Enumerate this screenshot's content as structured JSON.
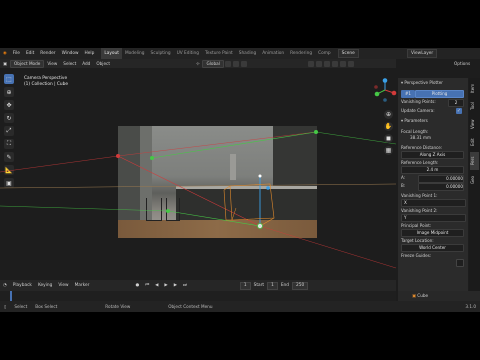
{
  "topbar": {
    "menus": [
      "File",
      "Edit",
      "Render",
      "Window",
      "Help"
    ],
    "workspaces": [
      "Layout",
      "Modeling",
      "Sculpting",
      "UV Editing",
      "Texture Paint",
      "Shading",
      "Animation",
      "Rendering",
      "Comp"
    ],
    "active_workspace": "Layout",
    "scene": "Scene",
    "view_layer": "ViewLayer"
  },
  "header": {
    "mode": "Object Mode",
    "menus": [
      "View",
      "Select",
      "Add",
      "Object"
    ],
    "orientation": "Global",
    "options": "Options"
  },
  "viewport": {
    "camera_label": "Camera Perspective",
    "collection_label": "(1) Collection | Cube"
  },
  "panel": {
    "title": "Perspective Plotter",
    "id_field": "#1",
    "plotting_button": "Plotting",
    "vanishing_points_label": "Vanishing Points:",
    "vanishing_points_value": "2",
    "update_camera_label": "Update Camera:",
    "parameters_header": "Parameters",
    "focal_length_label": "Focal Length:",
    "focal_length_value": "38.31 mm",
    "reference_distance_label": "Reference Distance:",
    "reference_distance_value": "Along Z Axis",
    "reference_length_label": "Reference Length:",
    "reference_length_value": "2.4 m",
    "a_label": "A:",
    "a_value": "0.00000",
    "b_label": "B:",
    "b_value": "0.00000",
    "vp1_label": "Vanishing Point 1:",
    "vp1_value": "X",
    "vp2_label": "Vanishing Point 2:",
    "vp2_value": "Y",
    "principal_point_label": "Principal Point:",
    "principal_point_value": "Image Midpoint",
    "target_location_label": "Target Location:",
    "target_location_value": "World Center",
    "freeze_guides_label": "Freeze Guides:"
  },
  "side_tabs": [
    "Item",
    "Tool",
    "View",
    "Edit",
    "Pers",
    "Geo"
  ],
  "timeline": {
    "menus": [
      "Playback",
      "Keying",
      "View",
      "Marker"
    ],
    "current_frame": "1",
    "start_label": "Start",
    "start_value": "1",
    "end_label": "End",
    "end_value": "250"
  },
  "outliner_item": "Cube",
  "status": {
    "select": "Select",
    "box_select": "Box Select",
    "rotate_view": "Rotate View",
    "context_menu": "Object Context Menu",
    "version": "3.1.0"
  },
  "colors": {
    "accent": "#4772b3",
    "green_line": "#46c846",
    "red_line": "#d23a3a",
    "orange_box": "#e08a2c",
    "blue_axis": "#3aa0e8"
  }
}
